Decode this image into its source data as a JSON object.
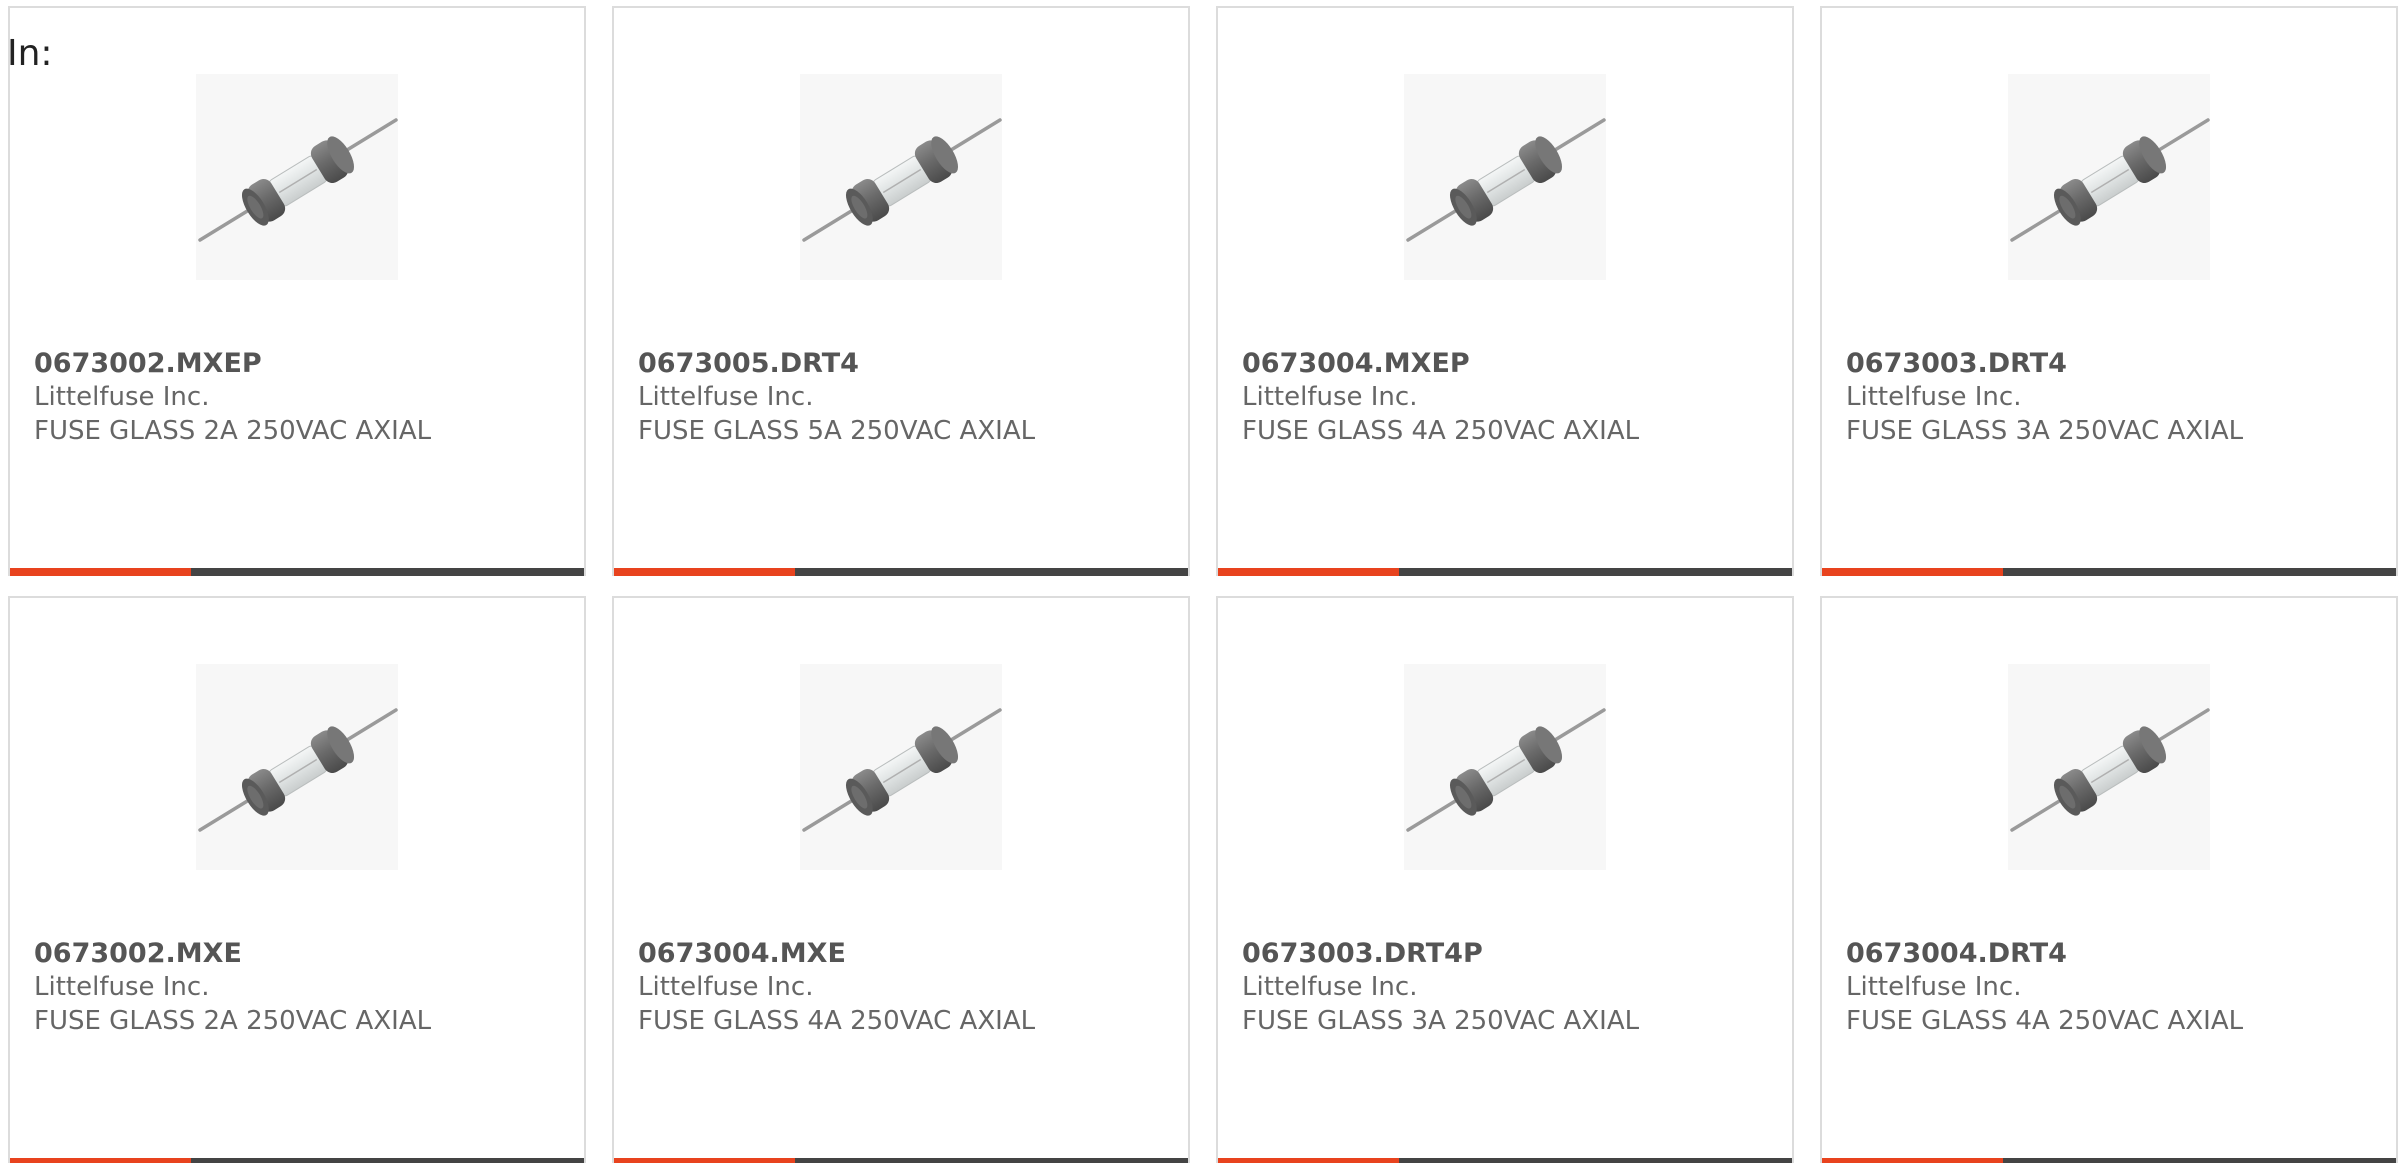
{
  "filter": {
    "label": "In:"
  },
  "accent_color": "#e8431e",
  "bar_color": "#444444",
  "products": [
    {
      "part_number": "0673002.MXEP",
      "manufacturer": "Littelfuse Inc.",
      "description": "FUSE GLASS 2A 250VAC AXIAL",
      "icon": "axial-glass-fuse-image"
    },
    {
      "part_number": "0673005.DRT4",
      "manufacturer": "Littelfuse Inc.",
      "description": "FUSE GLASS 5A 250VAC AXIAL",
      "icon": "axial-glass-fuse-image"
    },
    {
      "part_number": "0673004.MXEP",
      "manufacturer": "Littelfuse Inc.",
      "description": "FUSE GLASS 4A 250VAC AXIAL",
      "icon": "axial-glass-fuse-image"
    },
    {
      "part_number": "0673003.DRT4",
      "manufacturer": "Littelfuse Inc.",
      "description": "FUSE GLASS 3A 250VAC AXIAL",
      "icon": "axial-glass-fuse-image"
    },
    {
      "part_number": "0673002.MXE",
      "manufacturer": "Littelfuse Inc.",
      "description": "FUSE GLASS 2A 250VAC AXIAL",
      "icon": "axial-glass-fuse-image"
    },
    {
      "part_number": "0673004.MXE",
      "manufacturer": "Littelfuse Inc.",
      "description": "FUSE GLASS 4A 250VAC AXIAL",
      "icon": "axial-glass-fuse-image"
    },
    {
      "part_number": "0673003.DRT4P",
      "manufacturer": "Littelfuse Inc.",
      "description": "FUSE GLASS 3A 250VAC AXIAL",
      "icon": "axial-glass-fuse-image"
    },
    {
      "part_number": "0673004.DRT4",
      "manufacturer": "Littelfuse Inc.",
      "description": "FUSE GLASS 4A 250VAC AXIAL",
      "icon": "axial-glass-fuse-image"
    }
  ]
}
